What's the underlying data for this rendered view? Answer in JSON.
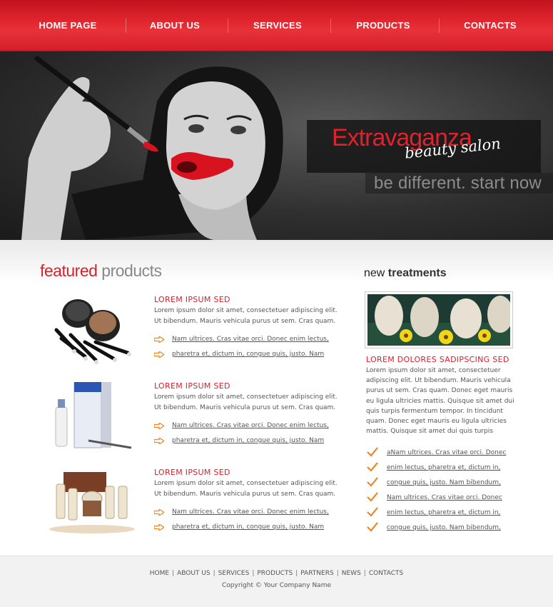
{
  "nav": {
    "items": [
      "HOME PAGE",
      "ABOUT US",
      "SERVICES",
      "PRODUCTS",
      "CONTACTS"
    ]
  },
  "hero": {
    "brand": "Extravaganza",
    "subtitle": "beauty salon",
    "tagline": "be different. start now"
  },
  "featured": {
    "title_a": "featured",
    "title_b": " products",
    "products": [
      {
        "name": "LOREM IPSUM SED",
        "desc": "Lorem ipsum dolor sit amet, consectetuer adipiscing elit. Ut bibendum. Mauris vehicula purus ut sem. Cras quam.",
        "links": [
          "Nam ultrices. Cras vitae orci. Donec enim lectus,",
          "pharetra et, dictum in, congue quis, justo. Nam"
        ]
      },
      {
        "name": "LOREM IPSUM SED",
        "desc": "Lorem ipsum dolor sit amet, consectetuer adipiscing elit. Ut bibendum. Mauris vehicula purus ut sem. Cras quam.",
        "links": [
          "Nam ultrices. Cras vitae orci. Donec enim lectus,",
          "pharetra et, dictum in, congue quis, justo. Nam"
        ]
      },
      {
        "name": "LOREM IPSUM SED",
        "desc": "Lorem ipsum dolor sit amet, consectetuer adipiscing elit. Ut bibendum. Mauris vehicula purus ut sem. Cras quam.",
        "links": [
          "Nam ultrices. Cras vitae orci. Donec enim lectus,",
          "pharetra et, dictum in, congue quis, justo. Nam"
        ]
      }
    ]
  },
  "treatments": {
    "title_a": "new",
    "title_b": " treatments",
    "name": "LOREM DOLORES SADIPSCING SED",
    "desc": "Lorem ipsum dolor sit amet, consectetuer adipiscing elit. Ut bibendum. Mauris vehicula purus ut sem. Cras quam. Donec eget mauris eu ligula ultricies mattis. Quisque sit amet dui quis turpis fermentum tempor. In tincidunt quam. Donec eget mauris eu ligula ultricies mattis. Quisque sit amet dui quis turpis",
    "items": [
      "aNam ultrices. Cras vitae orci. Donec",
      "enim lectus, pharetra et, dictum in,",
      "congue quis, justo. Nam bibendum,",
      "Nam ultrices. Cras vitae orci. Donec",
      "enim lectus, pharetra et, dictum in,",
      "congue quis, justo. Nam bibendum,"
    ]
  },
  "footer": {
    "links": [
      "HOME",
      "ABOUT US",
      "SERVICES",
      "PRODUCTS",
      "PARTNERS",
      "NEWS",
      "CONTACTS"
    ],
    "copyright": "Copyright © Your Company Name"
  },
  "colors": {
    "accent": "#d9212b",
    "nav_bg": "#e0242d",
    "arrow": "#e8892b"
  }
}
